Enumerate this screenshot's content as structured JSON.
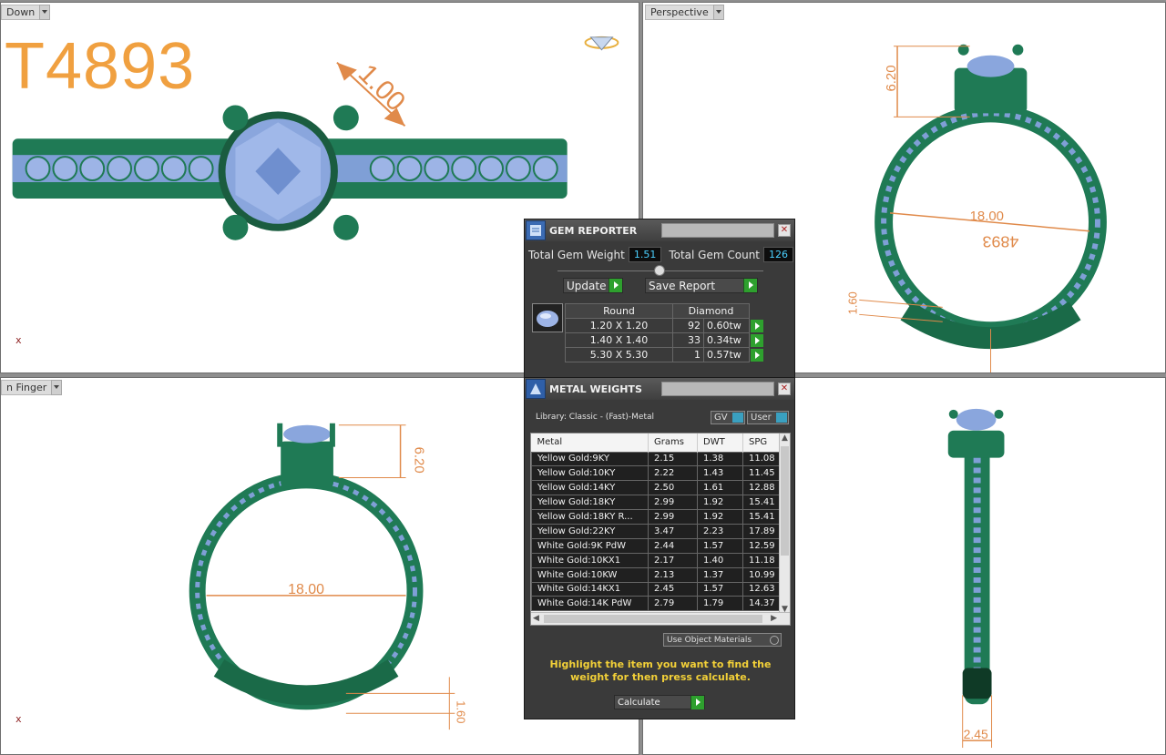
{
  "viewports": {
    "top_left": {
      "label": "Down"
    },
    "top_right": {
      "label": "Perspective"
    },
    "bottom_left": {
      "label": "n Finger"
    },
    "bottom_right": {
      "label": ""
    }
  },
  "model_code": "T4893",
  "mirrored_code": "4893",
  "axis_label": "x",
  "dimensions": {
    "prong": "1.00",
    "head_height_persp": "6.20",
    "inner_diameter_persp": "18.00",
    "band_thickness_persp": "1.60",
    "head_height_front": "6.20",
    "inner_diameter_front": "18.00",
    "band_thickness_front": "1.60",
    "band_width_side": "2.45"
  },
  "gem_reporter": {
    "title": "GEM REPORTER",
    "total_gem_weight_label": "Total Gem Weight",
    "total_gem_weight": "1.51",
    "total_gem_count_label": "Total Gem Count",
    "total_gem_count": "126",
    "update_label": "Update",
    "save_report_label": "Save Report",
    "shape_header": "Round",
    "material_header": "Diamond",
    "rows": [
      {
        "size": "1.20 X 1.20",
        "count": "92",
        "weight": "0.60tw"
      },
      {
        "size": "1.40 X 1.40",
        "count": "33",
        "weight": "0.34tw"
      },
      {
        "size": "5.30 X 5.30",
        "count": "1",
        "weight": "0.57tw"
      }
    ]
  },
  "metal_weights": {
    "title": "METAL WEIGHTS",
    "library": "Library: Classic - (Fast)-Metal",
    "gv_label": "GV",
    "user_label": "User",
    "columns": [
      "Metal",
      "Grams",
      "DWT",
      "SPG"
    ],
    "rows": [
      {
        "metal": "Yellow Gold:9KY",
        "grams": "2.15",
        "dwt": "1.38",
        "spg": "11.08"
      },
      {
        "metal": "Yellow Gold:10KY",
        "grams": "2.22",
        "dwt": "1.43",
        "spg": "11.45"
      },
      {
        "metal": "Yellow Gold:14KY",
        "grams": "2.50",
        "dwt": "1.61",
        "spg": "12.88"
      },
      {
        "metal": "Yellow Gold:18KY",
        "grams": "2.99",
        "dwt": "1.92",
        "spg": "15.41"
      },
      {
        "metal": "Yellow Gold:18KY R...",
        "grams": "2.99",
        "dwt": "1.92",
        "spg": "15.41"
      },
      {
        "metal": "Yellow Gold:22KY",
        "grams": "3.47",
        "dwt": "2.23",
        "spg": "17.89"
      },
      {
        "metal": "White Gold:9K PdW",
        "grams": "2.44",
        "dwt": "1.57",
        "spg": "12.59"
      },
      {
        "metal": "White Gold:10KX1",
        "grams": "2.17",
        "dwt": "1.40",
        "spg": "11.18"
      },
      {
        "metal": "White Gold:10KW",
        "grams": "2.13",
        "dwt": "1.37",
        "spg": "10.99"
      },
      {
        "metal": "White Gold:14KX1",
        "grams": "2.45",
        "dwt": "1.57",
        "spg": "12.63"
      },
      {
        "metal": "White Gold:14K PdW",
        "grams": "2.79",
        "dwt": "1.79",
        "spg": "14.37"
      }
    ],
    "use_object_materials": "Use Object Materials",
    "hint": "Highlight the item you want to find the weight for then press calculate.",
    "calculate_label": "Calculate"
  },
  "colors": {
    "metal_green": "#1f7a55",
    "gem_blue": "#8aa6dd",
    "dimension_orange": "#e08a4a",
    "title_orange": "#f0a040",
    "hint_yellow": "#f2d038",
    "value_cyan": "#4bd0ff"
  }
}
